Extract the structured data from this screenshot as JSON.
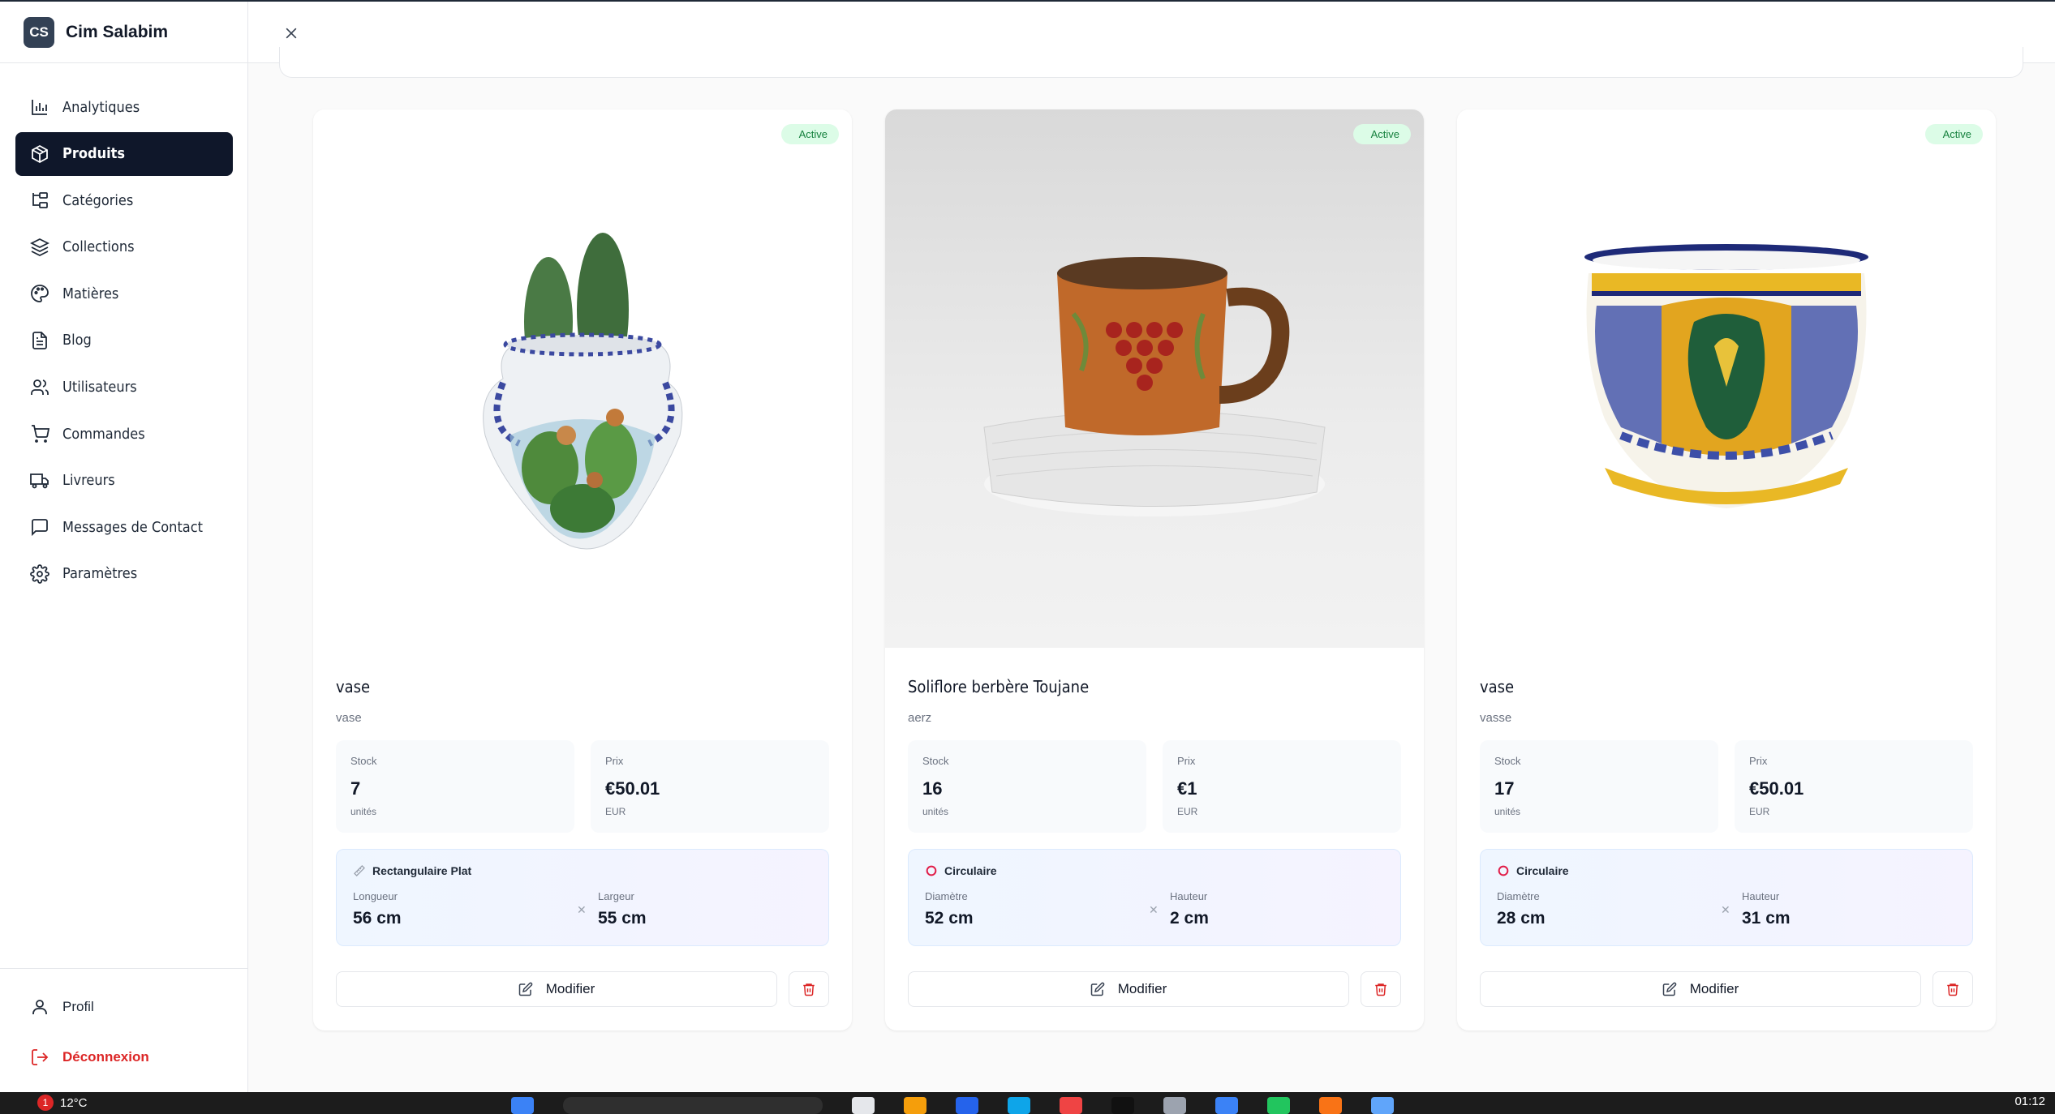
{
  "brand": {
    "logo": "CS",
    "name": "Cim Salabim"
  },
  "nav": [
    {
      "label": "Analytiques",
      "icon": "chart-bar-icon",
      "active": false
    },
    {
      "label": "Produits",
      "icon": "package-icon",
      "active": true
    },
    {
      "label": "Catégories",
      "icon": "folder-tree-icon",
      "active": false
    },
    {
      "label": "Collections",
      "icon": "layers-icon",
      "active": false
    },
    {
      "label": "Matières",
      "icon": "palette-icon",
      "active": false
    },
    {
      "label": "Blog",
      "icon": "file-text-icon",
      "active": false
    },
    {
      "label": "Utilisateurs",
      "icon": "users-icon",
      "active": false
    },
    {
      "label": "Commandes",
      "icon": "shopping-cart-icon",
      "active": false
    },
    {
      "label": "Livreurs",
      "icon": "truck-icon",
      "active": false
    },
    {
      "label": "Messages de Contact",
      "icon": "message-square-icon",
      "active": false
    },
    {
      "label": "Paramètres",
      "icon": "settings-icon",
      "active": false
    }
  ],
  "bottom": {
    "profile": "Profil",
    "logout": "Déconnexion"
  },
  "products": [
    {
      "status": "Active",
      "name": "vase",
      "subtitle": "vase",
      "stock_label": "Stock",
      "stock": "7",
      "stock_unit": "unités",
      "price_label": "Prix",
      "price": "€50.01",
      "currency": "EUR",
      "shape": "Rectangulaire Plat",
      "dim1_label": "Longueur",
      "dim1": "56 cm",
      "dim2_label": "Largeur",
      "dim2": "55 cm",
      "edit": "Modifier"
    },
    {
      "status": "Active",
      "name": "Soliflore berbère Toujane",
      "subtitle": "aerz",
      "stock_label": "Stock",
      "stock": "16",
      "stock_unit": "unités",
      "price_label": "Prix",
      "price": "€1",
      "currency": "EUR",
      "shape": "Circulaire",
      "dim1_label": "Diamètre",
      "dim1": "52 cm",
      "dim2_label": "Hauteur",
      "dim2": "2 cm",
      "edit": "Modifier"
    },
    {
      "status": "Active",
      "name": "vase",
      "subtitle": "vasse",
      "stock_label": "Stock",
      "stock": "17",
      "stock_unit": "unités",
      "price_label": "Prix",
      "price": "€50.01",
      "currency": "EUR",
      "shape": "Circulaire",
      "dim1_label": "Diamètre",
      "dim1": "28 cm",
      "dim2_label": "Hauteur",
      "dim2": "31 cm",
      "edit": "Modifier"
    }
  ],
  "colors": {
    "accent": "#0f172a",
    "active_badge": "#15803d",
    "danger": "#dc2626"
  },
  "taskbar": {
    "weather_badge": "1",
    "weather": "12°C",
    "time": "01:12"
  }
}
